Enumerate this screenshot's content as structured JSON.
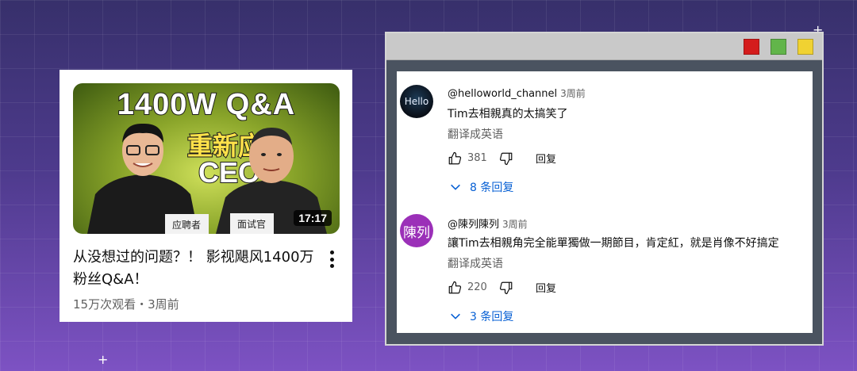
{
  "video": {
    "thumbnail_title_line1": "1400W Q&A",
    "thumbnail_title_line2": "重新应聘",
    "thumbnail_title_line3": "CEO?",
    "thumbnail_sign_left": "应聘者",
    "thumbnail_sign_right": "面试官",
    "duration": "17:17",
    "title": "从没想过的问题？！ 影视飓风1400万粉丝Q&A！",
    "meta": "15万次观看・3周前",
    "more_icon": "more-vert-icon"
  },
  "window": {
    "buttons": [
      {
        "name": "close",
        "color": "#d41c1c"
      },
      {
        "name": "maximize",
        "color": "#62b54a"
      },
      {
        "name": "minimize",
        "color": "#f0d232"
      }
    ]
  },
  "comments": [
    {
      "avatar_text": "Hello",
      "author": "@helloworld_channel",
      "time": "3周前",
      "text": "Tim去相親真的太搞笑了",
      "translate": "翻译成英语",
      "likes": "381",
      "reply": "回复",
      "replies": "8 条回复"
    },
    {
      "avatar_text": "陳列",
      "author": "@陳列陳列",
      "time": "3周前",
      "text": "讓Tim去相親角完全能單獨做一期節目，肯定紅，就是肖像不好搞定",
      "translate": "翻译成英语",
      "likes": "220",
      "reply": "回复",
      "replies": "3 条回复"
    }
  ],
  "colors": {
    "link_blue": "#065fd4",
    "avatar_purple": "#9b30b8"
  }
}
